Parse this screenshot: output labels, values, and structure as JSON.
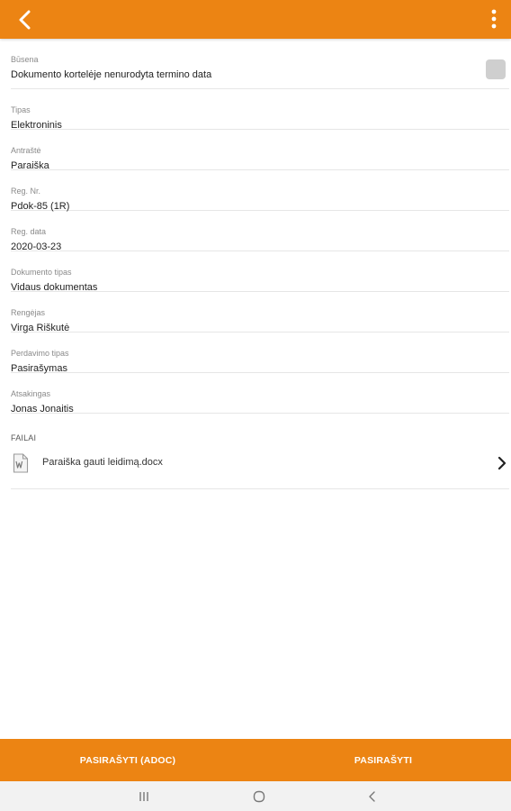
{
  "colors": {
    "accent": "#ec8413",
    "background": "#ffffff",
    "divider": "#e6e6e6"
  },
  "header": {
    "back_icon": "arrow-left-icon",
    "menu_icon": "more-vertical-icon"
  },
  "fields": [
    {
      "label": "Būsena",
      "value": "Dokumento kortelėje nenurodyta termino data"
    },
    {
      "label": "Tipas",
      "value": "Elektroninis"
    },
    {
      "label": "Antraštė",
      "value": "Paraiška"
    },
    {
      "label": "Reg. Nr.",
      "value": "Pdok-85 (1R)"
    },
    {
      "label": "Reg. data",
      "value": "2020-03-23"
    },
    {
      "label": "Dokumento tipas",
      "value": "Vidaus dokumentas"
    },
    {
      "label": "Rengėjas",
      "value": "Virga Riškutė"
    },
    {
      "label": "Perdavimo tipas",
      "value": "Pasirašymas"
    },
    {
      "label": "Atsakingas",
      "value": "Jonas Jonaitis"
    }
  ],
  "files": {
    "title": "FAILAI",
    "items": [
      {
        "name": "Paraiška gauti leidimą.docx",
        "icon": "word-document-icon"
      }
    ]
  },
  "actions": {
    "sign_adoc": "PASIRAŠYTI (ADOC)",
    "sign": "PASIRAŠYTI"
  },
  "system_nav": {
    "recents_icon": "recents-icon",
    "home_icon": "home-icon",
    "back_icon": "back-icon"
  }
}
